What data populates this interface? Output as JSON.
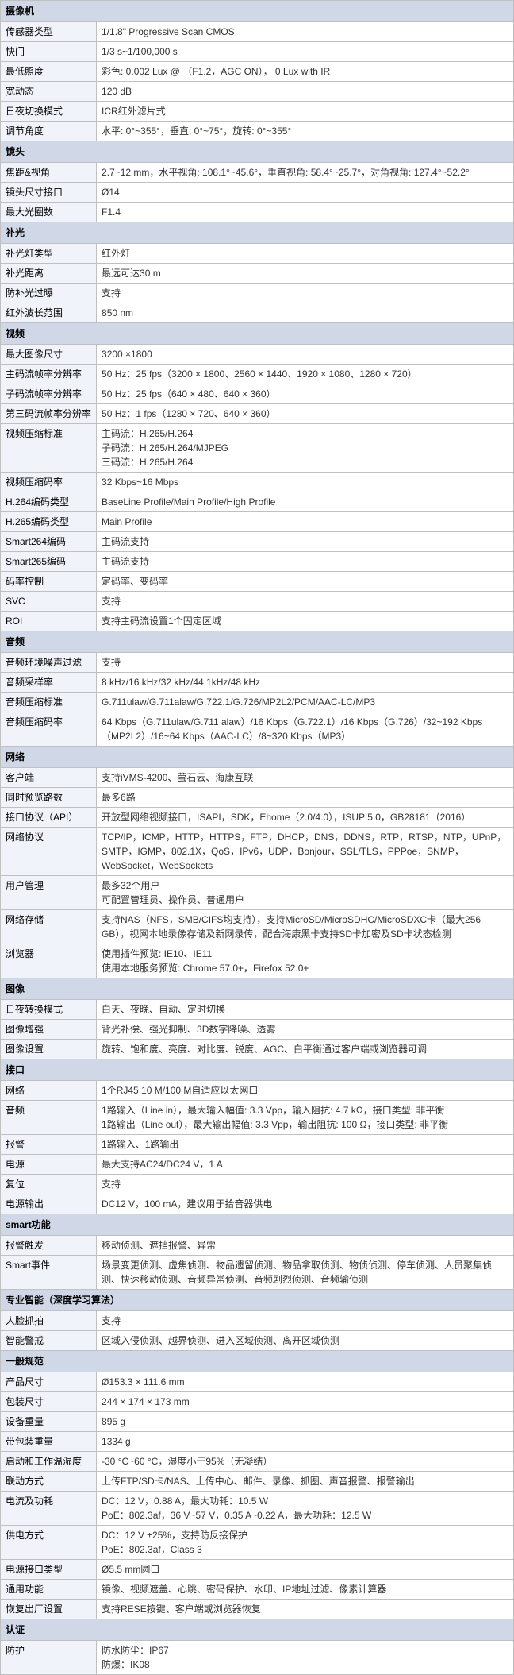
{
  "sections": [
    {
      "title": "摄像机",
      "rows": [
        {
          "label": "传感器类型",
          "value": "1/1.8\" Progressive Scan CMOS"
        },
        {
          "label": "快门",
          "value": "1/3 s~1/100,000 s"
        },
        {
          "label": "最低照度",
          "value": "彩色: 0.002 Lux @ （F1.2，AGC ON）， 0 Lux with IR"
        },
        {
          "label": "宽动态",
          "value": "120 dB"
        },
        {
          "label": "日夜切换模式",
          "value": "ICR红外滤片式"
        },
        {
          "label": "调节角度",
          "value": "水平: 0°~355°，垂直: 0°~75°，旋转: 0°~355°"
        }
      ]
    },
    {
      "title": "镜头",
      "rows": [
        {
          "label": "焦距&视角",
          "value": "2.7~12 mm，水平视角: 108.1°~45.6°，垂直视角: 58.4°~25.7°，对角视角: 127.4°~52.2°"
        },
        {
          "label": "镜头尺寸接口",
          "value": "Ø14"
        },
        {
          "label": "最大光圈数",
          "value": "F1.4"
        }
      ]
    },
    {
      "title": "补光",
      "rows": [
        {
          "label": "补光灯类型",
          "value": "红外灯"
        },
        {
          "label": "补光距离",
          "value": "最远可达30 m"
        },
        {
          "label": "防补光过曝",
          "value": "支持"
        },
        {
          "label": "红外波长范围",
          "value": "850 nm"
        }
      ]
    },
    {
      "title": "视频",
      "rows": [
        {
          "label": "最大图像尺寸",
          "value": "3200 ×1800"
        },
        {
          "label": "主码流帧率分辨率",
          "value": "50 Hz：25 fps（3200 × 1800、2560 × 1440、1920 × 1080、1280 × 720）"
        },
        {
          "label": "子码流帧率分辨率",
          "value": "50 Hz：25 fps（640 × 480、640 × 360）"
        },
        {
          "label": "第三码流帧率分辨率",
          "value": "50 Hz：1 fps（1280 × 720、640 × 360）"
        },
        {
          "label": "视频压缩标准",
          "value": "主码流：H.265/H.264\n子码流：H.265/H.264/MJPEG\n三码流：H.265/H.264"
        },
        {
          "label": "视频压缩码率",
          "value": "32 Kbps~16 Mbps"
        },
        {
          "label": "H.264编码类型",
          "value": "BaseLine Profile/Main Profile/High Profile"
        },
        {
          "label": "H.265编码类型",
          "value": "Main Profile"
        },
        {
          "label": "Smart264编码",
          "value": "主码流支持"
        },
        {
          "label": "Smart265编码",
          "value": "主码流支持"
        },
        {
          "label": "码率控制",
          "value": "定码率、变码率"
        },
        {
          "label": "SVC",
          "value": "支持"
        },
        {
          "label": "ROI",
          "value": "支持主码流设置1个固定区域"
        }
      ]
    },
    {
      "title": "音频",
      "rows": [
        {
          "label": "音频环境噪声过滤",
          "value": "支持"
        },
        {
          "label": "音频采样率",
          "value": "8 kHz/16 kHz/32 kHz/44.1kHz/48 kHz"
        },
        {
          "label": "音频压缩标准",
          "value": "G.711ulaw/G.711alaw/G.722.1/G.726/MP2L2/PCM/AAC-LC/MP3"
        },
        {
          "label": "音频压缩码率",
          "value": "64 Kbps（G.711ulaw/G.711 alaw）/16 Kbps（G.722.1）/16 Kbps（G.726）/32~192 Kbps（MP2L2）/16~64 Kbps（AAC-LC）/8~320 Kbps（MP3）"
        }
      ]
    },
    {
      "title": "网络",
      "rows": [
        {
          "label": "客户端",
          "value": "支持iVMS-4200、萤石云、海康互联"
        },
        {
          "label": "同时预览路数",
          "value": "最多6路"
        },
        {
          "label": "接口协议（API）",
          "value": "开放型网络视频接口，ISAPI，SDK，Ehome（2.0/4.0），ISUP 5.0，GB28181（2016）"
        },
        {
          "label": "网络协议",
          "value": "TCP/IP，ICMP，HTTP，HTTPS，FTP，DHCP，DNS，DDNS，RTP，RTSP，NTP，UPnP，SMTP，IGMP，802.1X，QoS，IPv6，UDP，Bonjour，SSL/TLS，PPPoe，SNMP，WebSocket，WebSockets"
        },
        {
          "label": "用户管理",
          "value": "最多32个用户\n可配置管理员、操作员、普通用户"
        },
        {
          "label": "网络存储",
          "value": "支持NAS（NFS，SMB/CIFS均支持），支持MicroSD/MicroSDHC/MicroSDXC卡（最大256 GB），视网本地录像存储及新网录传，配合海康黑卡支持SD卡加密及SD卡状态检测"
        },
        {
          "label": "浏览器",
          "value": "使用插件预览: IE10、IE11\n使用本地服务预览: Chrome 57.0+，Firefox 52.0+"
        }
      ]
    },
    {
      "title": "图像",
      "rows": [
        {
          "label": "日夜转换模式",
          "value": "白天、夜晚、自动、定时切换"
        },
        {
          "label": "图像增强",
          "value": "背光补偿、强光抑制、3D数字降噪、透雾"
        },
        {
          "label": "图像设置",
          "value": "旋转、饱和度、亮度、对比度、锐度、AGC、白平衡通过客户端或浏览器可调"
        }
      ]
    },
    {
      "title": "接口",
      "rows": [
        {
          "label": "网络",
          "value": "1个RJ45 10 M/100 M自适应以太网口"
        },
        {
          "label": "音频",
          "value": "1路输入（Line in），最大输入幅值: 3.3 Vpp，输入阻抗: 4.7 kΩ，接口类型: 非平衡\n1路输出（Line out），最大输出幅值: 3.3 Vpp，输出阻抗: 100 Ω，接口类型: 非平衡"
        },
        {
          "label": "报警",
          "value": "1路输入、1路输出"
        },
        {
          "label": "电源",
          "value": "最大支持AC24/DC24 V，1 A"
        },
        {
          "label": "复位",
          "value": "支持"
        },
        {
          "label": "电源输出",
          "value": "DC12 V，100 mA，建议用于拾音器供电"
        }
      ]
    },
    {
      "title": "smart功能",
      "rows": [
        {
          "label": "报警触发",
          "value": "移动侦测、遮挡报警、异常"
        },
        {
          "label": "Smart事件",
          "value": "场景变更侦测、虚焦侦测、物品遗留侦测、物品拿取侦测、物侦侦测、停车侦测、人员聚集侦测、快速移动侦测、音频异常侦测、音频剧烈侦测、音频输侦测"
        }
      ]
    },
    {
      "title": "专业智能（深度学习算法）",
      "rows": [
        {
          "label": "人脸抓拍",
          "value": "支持"
        },
        {
          "label": "智能警戒",
          "value": "区域入侵侦测、越界侦测、进入区域侦测、离开区域侦测"
        }
      ]
    },
    {
      "title": "一般规范",
      "rows": [
        {
          "label": "产品尺寸",
          "value": "Ø153.3 × 111.6 mm"
        },
        {
          "label": "包装尺寸",
          "value": "244 × 174 × 173 mm"
        },
        {
          "label": "设备重量",
          "value": "895 g"
        },
        {
          "label": "带包装重量",
          "value": "1334 g"
        },
        {
          "label": "启动和工作温湿度",
          "value": "-30 °C~60 °C，湿度小于95%（无凝结）"
        },
        {
          "label": "联动方式",
          "value": "上传FTP/SD卡/NAS、上传中心、邮件、录像、抓图、声音报警、报警输出"
        },
        {
          "label": "电流及功耗",
          "value": "DC：12 V，0.88 A，最大功耗：10.5 W\nPoE：802.3af，36 V~57 V，0.35 A~0.22 A，最大功耗：12.5 W"
        },
        {
          "label": "供电方式",
          "value": "DC：12 V ±25%，支持防反接保护\nPoE：802.3af，Class 3"
        },
        {
          "label": "电源接口类型",
          "value": "Ø5.5 mm圆口"
        },
        {
          "label": "通用功能",
          "value": "镜像、视频遮盖、心跳、密码保护、水印、IP地址过滤、像素计算器"
        },
        {
          "label": "恢复出厂设置",
          "value": "支持RESE按键、客户端或浏览器恢复"
        }
      ]
    },
    {
      "title": "认证",
      "rows": [
        {
          "label": "防护",
          "value": "防水防尘：IP67\n防爆：IK08"
        }
      ]
    }
  ]
}
